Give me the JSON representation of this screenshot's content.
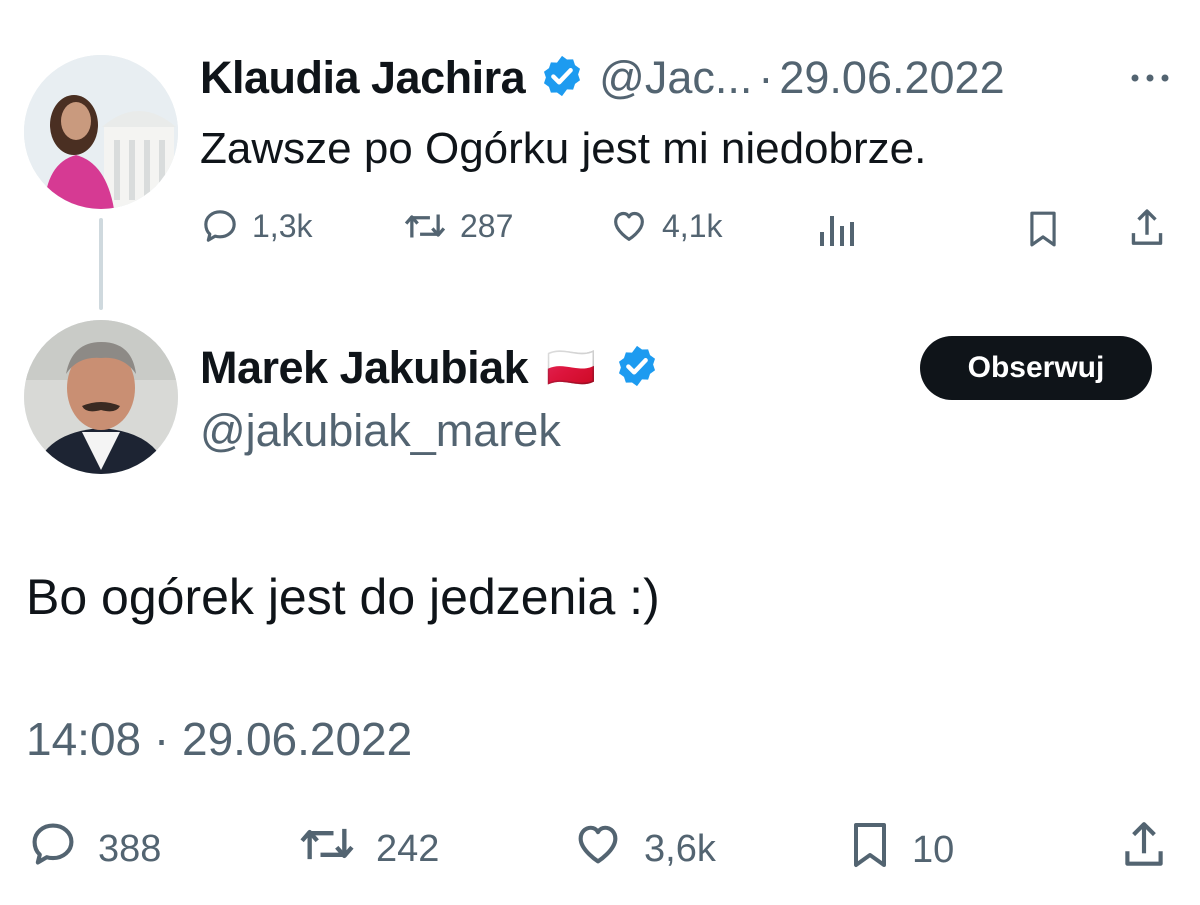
{
  "original_tweet": {
    "author_name": "Klaudia Jachira",
    "handle": "@Jac...",
    "separator": "·",
    "date": "29.06.2022",
    "text": "Zawsze po Ogórku jest mi niedobrze.",
    "stats": {
      "replies": "1,3k",
      "retweets": "287",
      "likes": "4,1k"
    }
  },
  "reply_tweet": {
    "author_name": "Marek Jakubiak",
    "flag": "🇵🇱",
    "handle": "@jakubiak_marek",
    "follow_label": "Obserwuj",
    "text": "Bo ogórek jest do jedzenia :)",
    "timestamp": "14:08 · 29.06.2022",
    "stats": {
      "replies": "388",
      "retweets": "242",
      "likes": "3,6k",
      "bookmarks": "10"
    }
  },
  "colors": {
    "verified": "#1d9bf0",
    "muted": "#536471",
    "button_bg": "#0f1419"
  }
}
